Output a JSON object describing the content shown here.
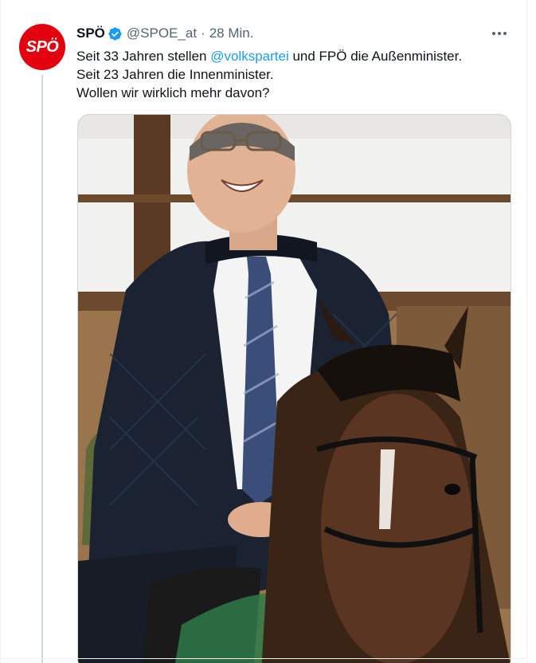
{
  "tweet": {
    "author_name": "SPÖ",
    "avatar_text": "SPÖ",
    "handle": "@SPOE_at",
    "separator": "·",
    "time": "28 Min.",
    "text_line1_before": "Seit 33 Jahren stellen ",
    "mention": "@volkspartei",
    "text_line1_after": " und FPÖ die Außenminister.",
    "text_line2": "Seit 23 Jahren die Innenminister.",
    "text_line3": "Wollen wir wirklich mehr davon?"
  },
  "colors": {
    "brand_red": "#e3000f",
    "link_blue": "#1d9bf0",
    "verified_blue": "#1d9bf0",
    "secondary_text": "#536471"
  },
  "icons": {
    "verified": "verified-badge-icon",
    "more": "more-options-icon"
  }
}
